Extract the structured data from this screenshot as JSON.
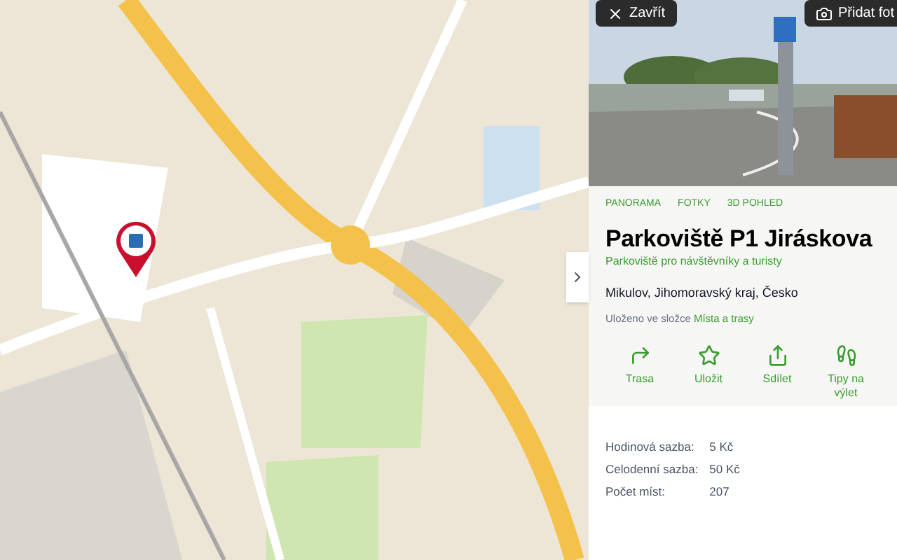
{
  "map": {
    "kind": "picture"
  },
  "panel": {
    "close_button": "Zavřít",
    "add_photo_button": "Přidat fot",
    "photo": {
      "kind": "picture"
    },
    "view_tabs": [
      "PANORAMA",
      "FOTKY",
      "3D POHLED"
    ],
    "title": "Parkoviště P1 Jiráskova",
    "subtitle": "Parkoviště pro návštěvníky a turisty",
    "address": "Mikulov, Jihomoravský kraj, Česko",
    "saved_prefix": "Uloženo ve složce",
    "saved_folder": "Místa a trasy",
    "actions": [
      {
        "kind": "route",
        "label": "Trasa"
      },
      {
        "kind": "save",
        "label": "Uložit"
      },
      {
        "kind": "share",
        "label": "Sdílet"
      },
      {
        "kind": "trip",
        "label": "Tipy na výlet"
      }
    ],
    "details": [
      {
        "label": "Hodinová sazba:",
        "value": "5 Kč"
      },
      {
        "label": "Celodenní sazba:",
        "value": "50 Kč"
      },
      {
        "label": "Počet míst:",
        "value": "207"
      }
    ]
  }
}
